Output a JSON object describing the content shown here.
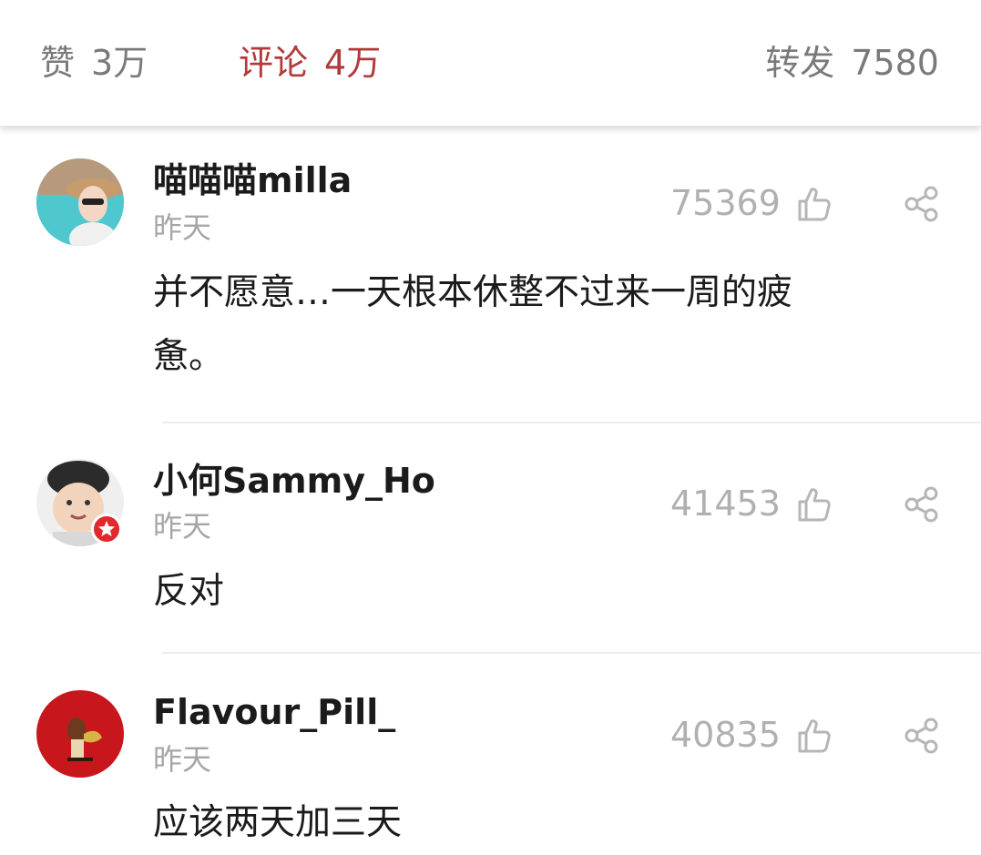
{
  "tabs": {
    "like": {
      "label": "赞",
      "count": "3万"
    },
    "comment": {
      "label": "评论",
      "count": "4万"
    },
    "repost": {
      "label": "转发",
      "count": "7580"
    }
  },
  "colors": {
    "accent": "#b23a3a",
    "muted": "#a6a6a6",
    "verified_badge": "#e0282d"
  },
  "icons": {
    "like": "thumbs-up-outline-icon",
    "share": "share-icon",
    "verified": "verified-badge-icon"
  },
  "comments": [
    {
      "username": "喵喵喵milla",
      "time": "昨天",
      "likes": "75369",
      "text": "并不愿意…一天根本休整不过来一周的疲惫。"
    },
    {
      "username": "小何Sammy_Ho",
      "time": "昨天",
      "likes": "41453",
      "text": "反对"
    },
    {
      "username": "Flavour_Pill_",
      "time": "昨天",
      "likes": "40835",
      "text": "应该两天加三天"
    }
  ]
}
